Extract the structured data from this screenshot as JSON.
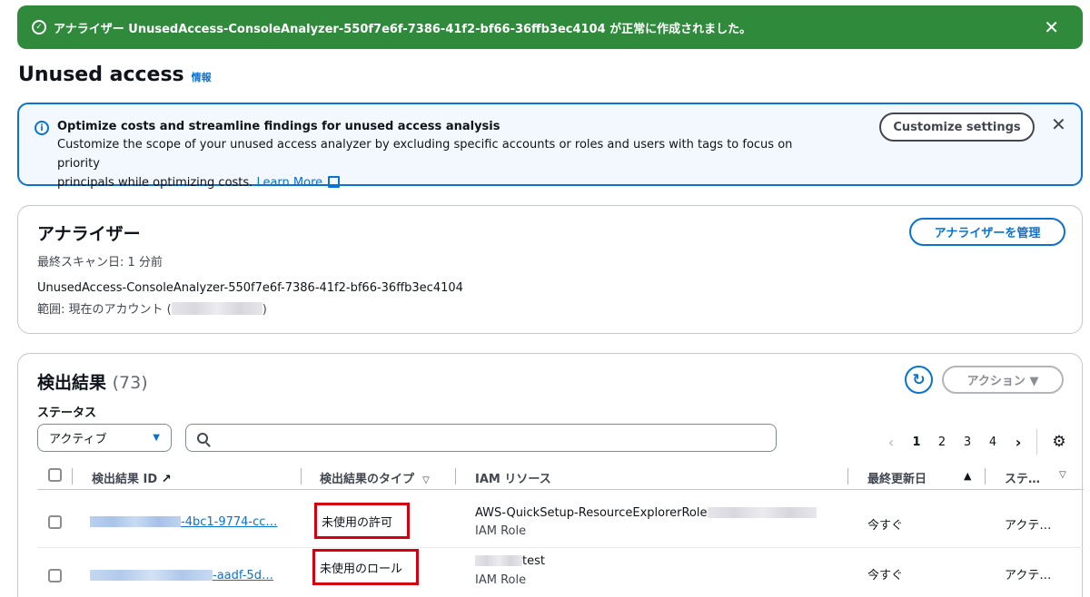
{
  "flash": {
    "message": "アナライザー UnusedAccess-ConsoleAnalyzer-550f7e6f-7386-41f2-bf66-36ffb3ec4104 が正常に作成されました。",
    "close": "✕"
  },
  "page": {
    "title": "Unused access",
    "info_link": "情報"
  },
  "alert": {
    "title": "Optimize costs and streamline findings for unused access analysis",
    "text1": "Customize the scope of your unused access analyzer by excluding specific accounts or roles and users with tags to focus on priority",
    "text2": "principals while optimizing costs.",
    "learn_more": "Learn More",
    "button": "Customize settings",
    "close": "✕"
  },
  "analyzer": {
    "heading": "アナライザー",
    "last_scan": "最終スキャン日: 1 分前",
    "name": "UnusedAccess-ConsoleAnalyzer-550f7e6f-7386-41f2-bf66-36ffb3ec4104",
    "scope_prefix": "範囲: 現在のアカウント (",
    "scope_suffix": ")",
    "manage_button": "アナライザーを管理"
  },
  "findings": {
    "heading": "検出結果",
    "count": "(73)",
    "actions_button": "アクション ▼",
    "status_label": "ステータス",
    "status_value": "アクティブ",
    "pages": [
      "1",
      "2",
      "3",
      "4"
    ],
    "columns": {
      "id": "検出結果 ID",
      "type": "検出結果のタイプ",
      "resource": "IAM リソース",
      "updated": "最終更新日",
      "status": "ステ…"
    },
    "rows": [
      {
        "id_suffix": "-4bc1-9774-cc…",
        "type": "未使用の許可",
        "resource": "AWS-QuickSetup-ResourceExplorerRole",
        "resource_type": "IAM Role",
        "updated": "今すぐ",
        "status": "アクテ…"
      },
      {
        "id_suffix": "-aadf-5d…",
        "type": "未使用のロール",
        "resource": "test",
        "resource_type": "IAM Role",
        "updated": "今すぐ",
        "status": "アクテ…"
      }
    ]
  }
}
